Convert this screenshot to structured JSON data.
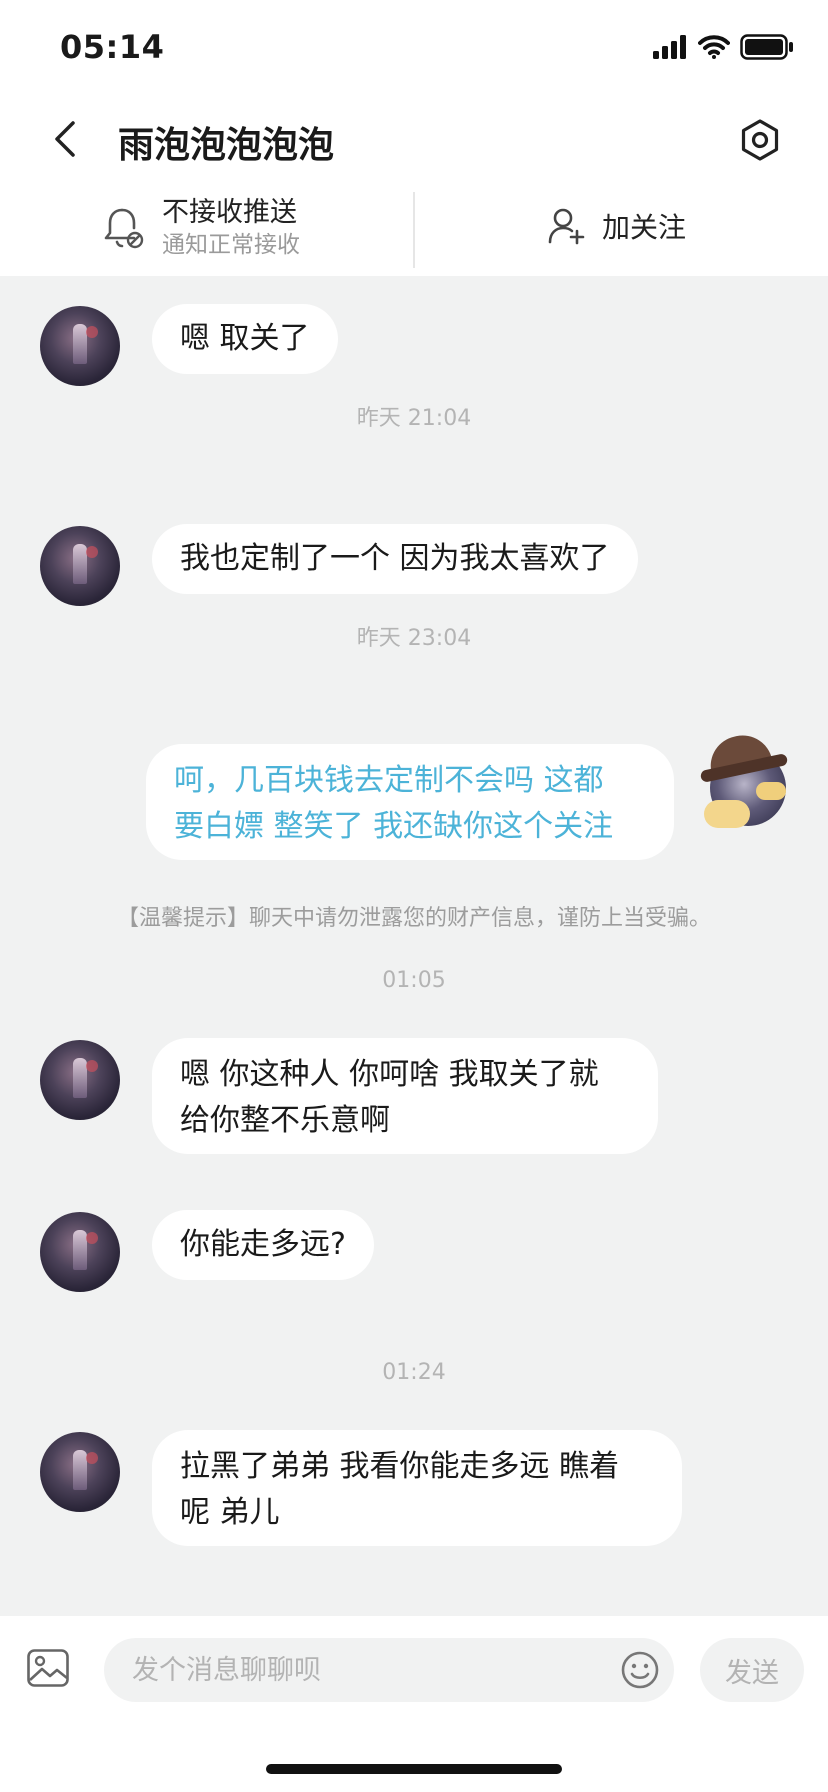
{
  "status_bar": {
    "time": "05:14"
  },
  "header": {
    "title": "雨泡泡泡泡泡"
  },
  "sub_bar": {
    "notify_main": "不接收推送",
    "notify_sub": "通知正常接收",
    "follow_label": "加关注"
  },
  "messages": [
    {
      "type": "message",
      "from": "other",
      "text": "嗯 取关了"
    },
    {
      "type": "time",
      "text": "昨天 21:04"
    },
    {
      "type": "message",
      "from": "other",
      "text": "我也定制了一个 因为我太喜欢了"
    },
    {
      "type": "time",
      "text": "昨天 23:04"
    },
    {
      "type": "message",
      "from": "self",
      "lines": [
        "呵，几百块钱去定制不会吗 这都",
        "要白嫖 整笑了 我还缺你这个关注"
      ]
    },
    {
      "type": "tip",
      "text": "【温馨提示】聊天中请勿泄露您的财产信息，谨防上当受骗。"
    },
    {
      "type": "time",
      "text": "01:05"
    },
    {
      "type": "message",
      "from": "other",
      "lines": [
        "嗯 你这种人 你呵啥 我取关了就",
        "给你整不乐意啊"
      ]
    },
    {
      "type": "message",
      "from": "other",
      "text": "你能走多远?"
    },
    {
      "type": "time",
      "text": "01:24"
    },
    {
      "type": "message",
      "from": "other",
      "lines": [
        "拉黑了弟弟 我看你能走多远 瞧着",
        "呢 弟儿"
      ]
    }
  ],
  "input": {
    "placeholder": "发个消息聊聊呗",
    "send_label": "发送"
  },
  "icons": {
    "back": "chevron-left-icon",
    "settings": "hexagon-gear-icon",
    "notify": "bell-off-icon",
    "follow": "add-user-icon",
    "image": "image-icon",
    "emoji": "smile-icon"
  },
  "colors": {
    "chat_bg": "#f1f2f2",
    "self_text": "#4cb3d8",
    "timestamp": "#b4b4b4"
  }
}
